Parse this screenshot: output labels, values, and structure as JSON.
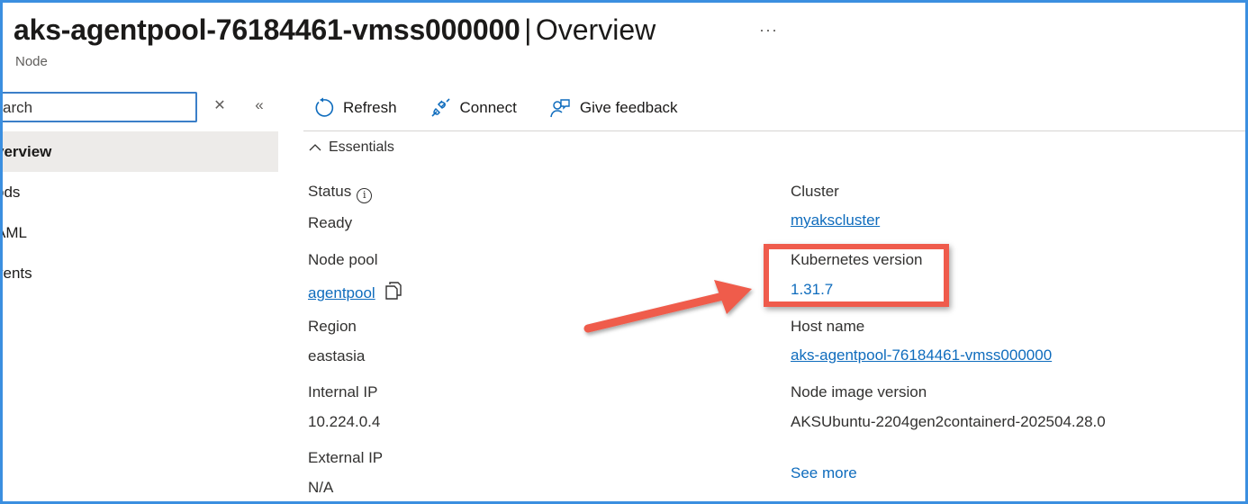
{
  "header": {
    "title_resource": "aks-agentpool-76184461-vmss000000",
    "title_separator": "|",
    "title_section": "Overview",
    "more_label": "···",
    "subtitle": "Node"
  },
  "sidebar": {
    "search_value": "arch",
    "clear_label": "✕",
    "collapse_label": "«",
    "items": [
      {
        "label": "verview",
        "selected": true
      },
      {
        "label": "ods"
      },
      {
        "label": "AML"
      },
      {
        "label": "vents"
      }
    ]
  },
  "toolbar": {
    "refresh_label": "Refresh",
    "connect_label": "Connect",
    "feedback_label": "Give feedback"
  },
  "essentials": {
    "toggle_label": "Essentials",
    "status_label": "Status",
    "status_value": "Ready",
    "node_pool_label": "Node pool",
    "node_pool_value": "agentpool",
    "region_label": "Region",
    "region_value": "eastasia",
    "internal_ip_label": "Internal IP",
    "internal_ip_value": "10.224.0.4",
    "external_ip_label": "External IP",
    "external_ip_value": "N/A",
    "cluster_label": "Cluster",
    "cluster_value": "myakscluster",
    "k8s_version_label": "Kubernetes version",
    "k8s_version_value": "1.31.7",
    "host_name_label": "Host name",
    "host_name_value": "aks-agentpool-76184461-vmss000000",
    "node_image_label": "Node image version",
    "node_image_value": "AKSUbuntu-2204gen2containerd-202504.28.0",
    "see_more_label": "See more"
  },
  "colors": {
    "accent": "#0f6cbd",
    "frame": "#3b8fe0",
    "annotation": "#ef5b4c",
    "selected_bg": "#edebe9"
  }
}
